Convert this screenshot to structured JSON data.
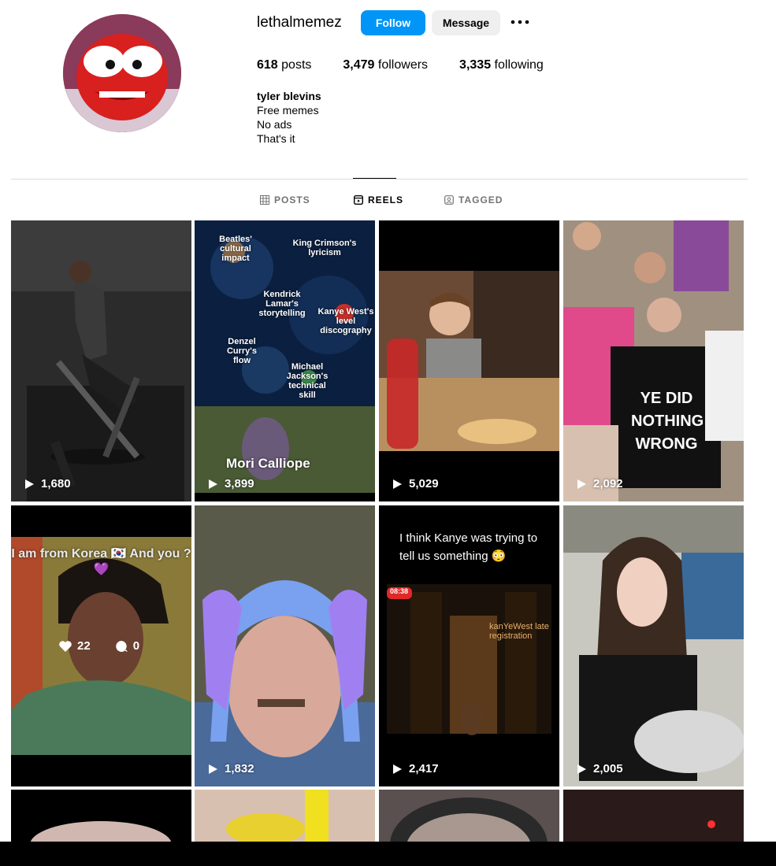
{
  "profile": {
    "username": "lethalmemez",
    "follow_label": "Follow",
    "message_label": "Message",
    "more_icon": "more-horizontal-icon",
    "posts_count": "618",
    "posts_label": "posts",
    "followers_count": "3,479",
    "followers_label": "followers",
    "following_count": "3,335",
    "following_label": "following",
    "bio_name": "tyler blevins",
    "bio_lines": [
      "Free memes",
      "No ads",
      "That's it"
    ]
  },
  "tabs": [
    {
      "label": "POSTS",
      "icon": "grid-icon"
    },
    {
      "label": "REELS",
      "icon": "reels-icon"
    },
    {
      "label": "TAGGED",
      "icon": "tagged-icon"
    }
  ],
  "reels": [
    {
      "views": "1,680"
    },
    {
      "views": "3,899",
      "caption": "Mori Calliope",
      "labels": [
        "Beatles' cultural impact",
        "King Crimson's lyricism",
        "Kendrick Lamar's storytelling",
        "Kanye West's level discography",
        "Denzel Curry's flow",
        "Michael Jackson's technical skill"
      ]
    },
    {
      "views": "5,029"
    },
    {
      "views": "2,092",
      "shirt_text": "YE DID NOTHING WRONG"
    },
    {
      "likes": "22",
      "comments": "0",
      "caption": "I am from Korea 🇰🇷 And you ?💜"
    },
    {
      "views": "1,832"
    },
    {
      "views": "2,417",
      "caption": "I think Kanye was trying to tell us something 😳",
      "phone_time": "08:38",
      "album_text": "kanYeWest late registration"
    },
    {
      "views": "2,005"
    }
  ],
  "colors": {
    "accent": "#0095f6",
    "divider": "#dbdbdb",
    "muted": "#737373"
  }
}
